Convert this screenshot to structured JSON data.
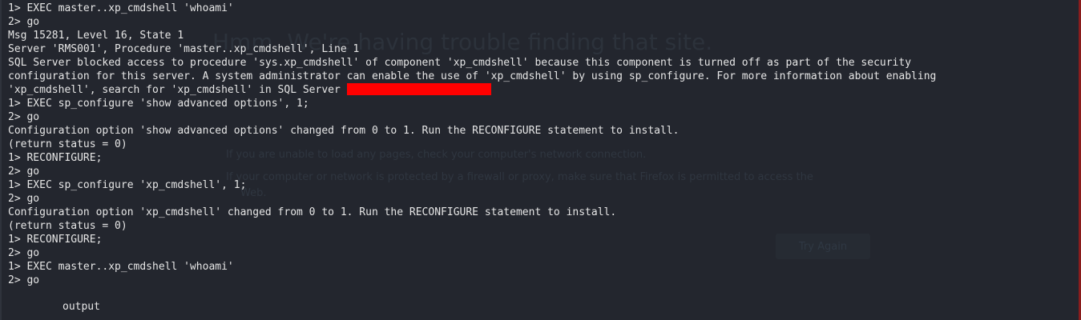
{
  "background_page": {
    "title": "Hmm. We're having trouble finding that site.",
    "hints": [
      "If you are unable to load any pages, check your computer's network connection.",
      "If your computer or network is protected by a firewall or proxy, make sure that Firefox is permitted to access the",
      "Web."
    ],
    "try_again_button": "Try Again"
  },
  "terminal": {
    "lines": [
      "1> EXEC master..xp_cmdshell 'whoami'",
      "2> go",
      "Msg 15281, Level 16, State 1",
      "Server 'RMS001', Procedure 'master..xp_cmdshell', Line 1",
      "SQL Server blocked access to procedure 'sys.xp_cmdshell' of component 'xp_cmdshell' because this component is turned off as part of the security",
      "configuration for this server. A system administrator can enable the use of 'xp_cmdshell' by using sp_configure. For more information about enabling",
      "'xp_cmdshell', search for 'xp_cmdshell' in SQL Server ",
      "1> EXEC sp_configure 'show advanced options', 1;",
      "2> go",
      "Configuration option 'show advanced options' changed from 0 to 1. Run the RECONFIGURE statement to install.",
      "(return status = 0)",
      "1> RECONFIGURE;",
      "2> go",
      "1> EXEC sp_configure 'xp_cmdshell', 1;",
      "2> go",
      "Configuration option 'xp_cmdshell' changed from 0 to 1. Run the RECONFIGURE statement to install.",
      "(return status = 0)",
      "1> RECONFIGURE;",
      "2> go",
      "1> EXEC master..xp_cmdshell 'whoami'",
      "2> go"
    ],
    "output_label": "output"
  },
  "colors": {
    "background": "#23262e",
    "text": "#e6e6e6",
    "redaction": "#ff0000",
    "right_edge": "#8a1d1d"
  }
}
